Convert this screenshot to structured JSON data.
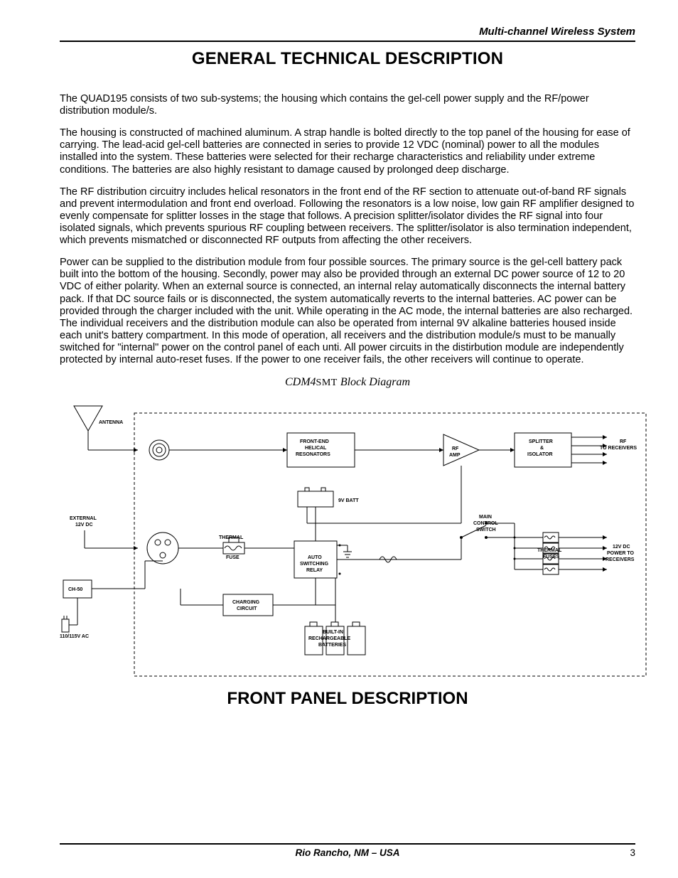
{
  "header": {
    "running": "Multi-channel Wireless System"
  },
  "titles": {
    "h1": "GENERAL TECHNICAL DESCRIPTION",
    "h2": "FRONT PANEL DESCRIPTION"
  },
  "paragraphs": {
    "p1": "The QUAD195 consists of two sub-systems; the housing which contains the gel-cell power supply and the RF/power distribution module/s.",
    "p2": "The housing is constructed of machined aluminum.  A strap handle is bolted directly to the top panel of the housing for ease of carrying.  The lead-acid gel-cell batteries are connected in series to provide 12 VDC (nominal) power to all the modules installed into the system.  These batteries were selected for their recharge characteristics and reliability under extreme conditions.  The batteries are also highly resistant to damage caused by prolonged deep discharge.",
    "p3": "The RF distribution circuitry includes helical resonators in the front end of the RF section to attenuate out-of-band RF signals and prevent intermodulation and front end overload.  Following the resonators is a low noise, low gain RF amplifier designed to evenly compensate for splitter losses in the stage that follows.  A precision splitter/isolator divides the RF signal into four isolated signals, which prevents spurious RF coupling between receivers.  The splitter/isolator is also termination independent, which prevents mismatched or disconnected RF outputs from affecting the other receivers.",
    "p4": "Power can be supplied to the distribution module from four possible sources.  The primary source is the gel-cell battery pack built into the bottom of the housing.  Secondly, power may also be provided through an external DC power source of 12 to 20 VDC of either polarity.  When an external source is connected, an internal relay automatically disconnects the internal battery pack.  If that DC source fails or is disconnected, the system automatically reverts to the internal batteries.  AC power can be provided through the charger included with the unit.  While operating in the AC mode, the internal batteries are also recharged.  The individual receivers and the distribution module can also be operated from internal 9V alkaline batteries housed inside each unit's battery compartment.  In this mode of operation, all receivers and the distribution module/s must to be manually switched for \"internal\" power on the control panel of each unti.  All power circuits in the distirbution module are independently protected by internal auto-reset fuses.  If the power to one receiver fails, the other receivers will continue to operate."
  },
  "diagram": {
    "caption_prefix": "CDM4",
    "caption_small": "SMT",
    "caption_suffix": " Block Diagram",
    "labels": {
      "antenna": "ANTENNA",
      "front_end": "FRONT-END HELICAL RESONATORS",
      "rf_amp": "RF AMP",
      "splitter": "SPLITTER & ISOLATOR",
      "rf_to": "RF TO RECEIVERS",
      "ext_12v": "EXTERNAL 12V DC",
      "nine_v": "9V BATT",
      "thermal": "THERMAL FUSE",
      "auto_sw": "AUTO SWITCHING RELAY",
      "main_sw": "MAIN CONTROL SWITCH",
      "thermal_fuses": "THERMAL FUSES",
      "power_to": "12V DC POWER TO RECEIVERS",
      "ch50": "CH-50",
      "charging": "CHARGING CIRCUIT",
      "builtin": "BUILT-IN RECHARGEABLE BATTERIES",
      "ac": "110/115V AC"
    }
  },
  "footer": {
    "location": "Rio Rancho, NM – USA",
    "page": "3"
  }
}
